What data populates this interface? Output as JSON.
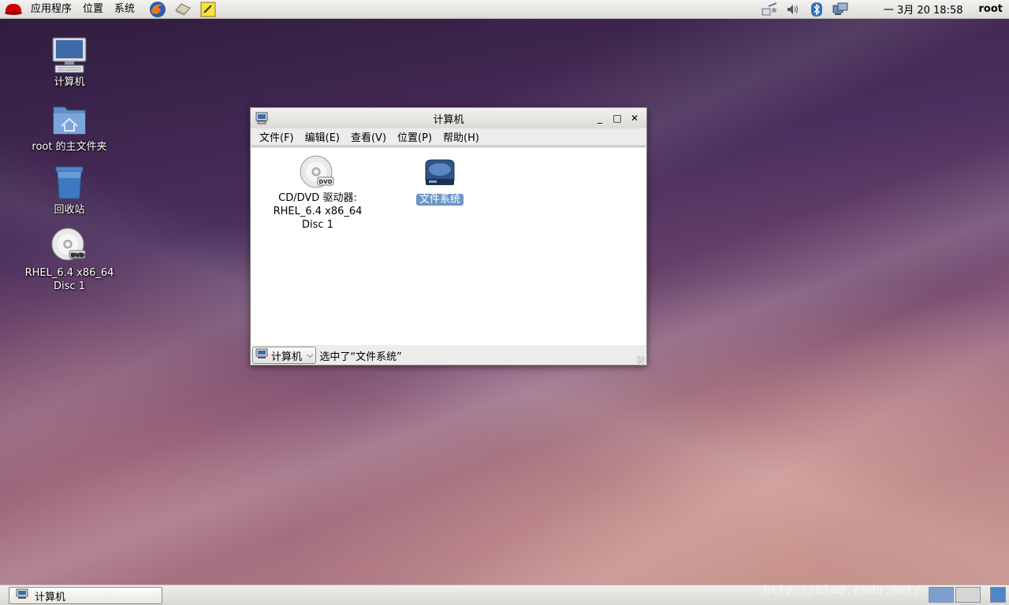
{
  "top_panel": {
    "menus": [
      "应用程序",
      "位置",
      "系统"
    ],
    "launchers": [
      "firefox-icon",
      "mail-icon",
      "notes-icon"
    ],
    "tray": [
      "network-icon",
      "volume-icon",
      "bluetooth-icon",
      "display-icon"
    ],
    "clock": "一 3月 20 18:58",
    "user": "root"
  },
  "desktop": {
    "icons": [
      {
        "label": "计算机",
        "icon": "computer-icon"
      },
      {
        "label": "root 的主文件夹",
        "icon": "home-folder-icon"
      },
      {
        "label": "回收站",
        "icon": "trash-icon"
      },
      {
        "label": "RHEL_6.4 x86_64 Disc 1",
        "label_lines": [
          "RHEL_6.4 x86_64",
          "Disc 1"
        ],
        "icon": "dvd-icon"
      }
    ]
  },
  "window": {
    "title": "计算机",
    "controls": {
      "minimize": "_",
      "maximize": "□",
      "close": "✕"
    },
    "menu": [
      "文件(F)",
      "编辑(E)",
      "查看(V)",
      "位置(P)",
      "帮助(H)"
    ],
    "items": [
      {
        "label_lines": [
          "CD/DVD 驱动器:",
          "RHEL_6.4 x86_64",
          "Disc 1"
        ],
        "icon": "dvd-drive-icon",
        "selected": false
      },
      {
        "label": "文件系统",
        "icon": "filesystem-drive-icon",
        "selected": true
      }
    ],
    "status": {
      "location": "计算机",
      "message": "选中了“文件系统”"
    }
  },
  "bottom_panel": {
    "task": "计算机",
    "watermark": "http://blog.csdn.net/"
  },
  "colors": {
    "selection": "#6a95c8",
    "panel": "#e6e4e0"
  }
}
